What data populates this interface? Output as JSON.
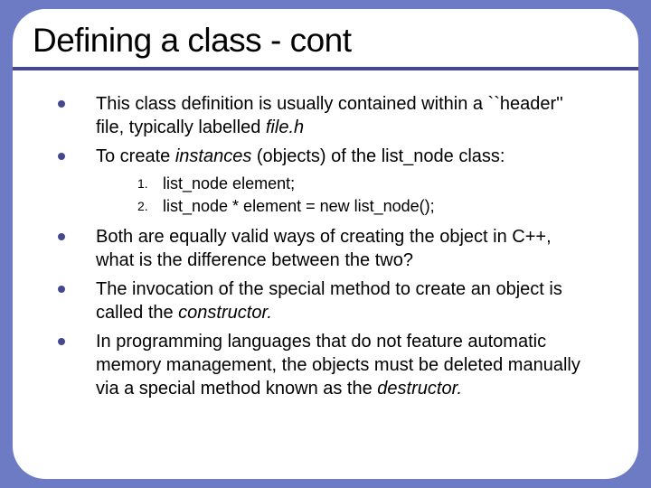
{
  "title": "Defining a class - cont",
  "bullets": [
    {
      "pre": "This class definition is usually contained within a ``header'' file, typically labelled ",
      "italic": "file.h",
      "post": ""
    },
    {
      "pre": "To create ",
      "italic": "instances",
      "post": " (objects) of the list_node class:"
    }
  ],
  "sublist": [
    {
      "num": "1.",
      "text": "list_node element;"
    },
    {
      "num": "2.",
      "text": "list_node * element = new list_node();"
    }
  ],
  "bullets2": [
    {
      "pre": "Both are equally valid ways of creating the object in C++, what is the difference between the two?",
      "italic": "",
      "post": ""
    },
    {
      "pre": "The invocation of the special method to create an object is called the ",
      "italic": "constructor.",
      "post": ""
    },
    {
      "pre": "In programming languages that do not feature automatic memory management, the objects must be deleted manually via a special method known as the ",
      "italic": "destructor.",
      "post": ""
    }
  ]
}
